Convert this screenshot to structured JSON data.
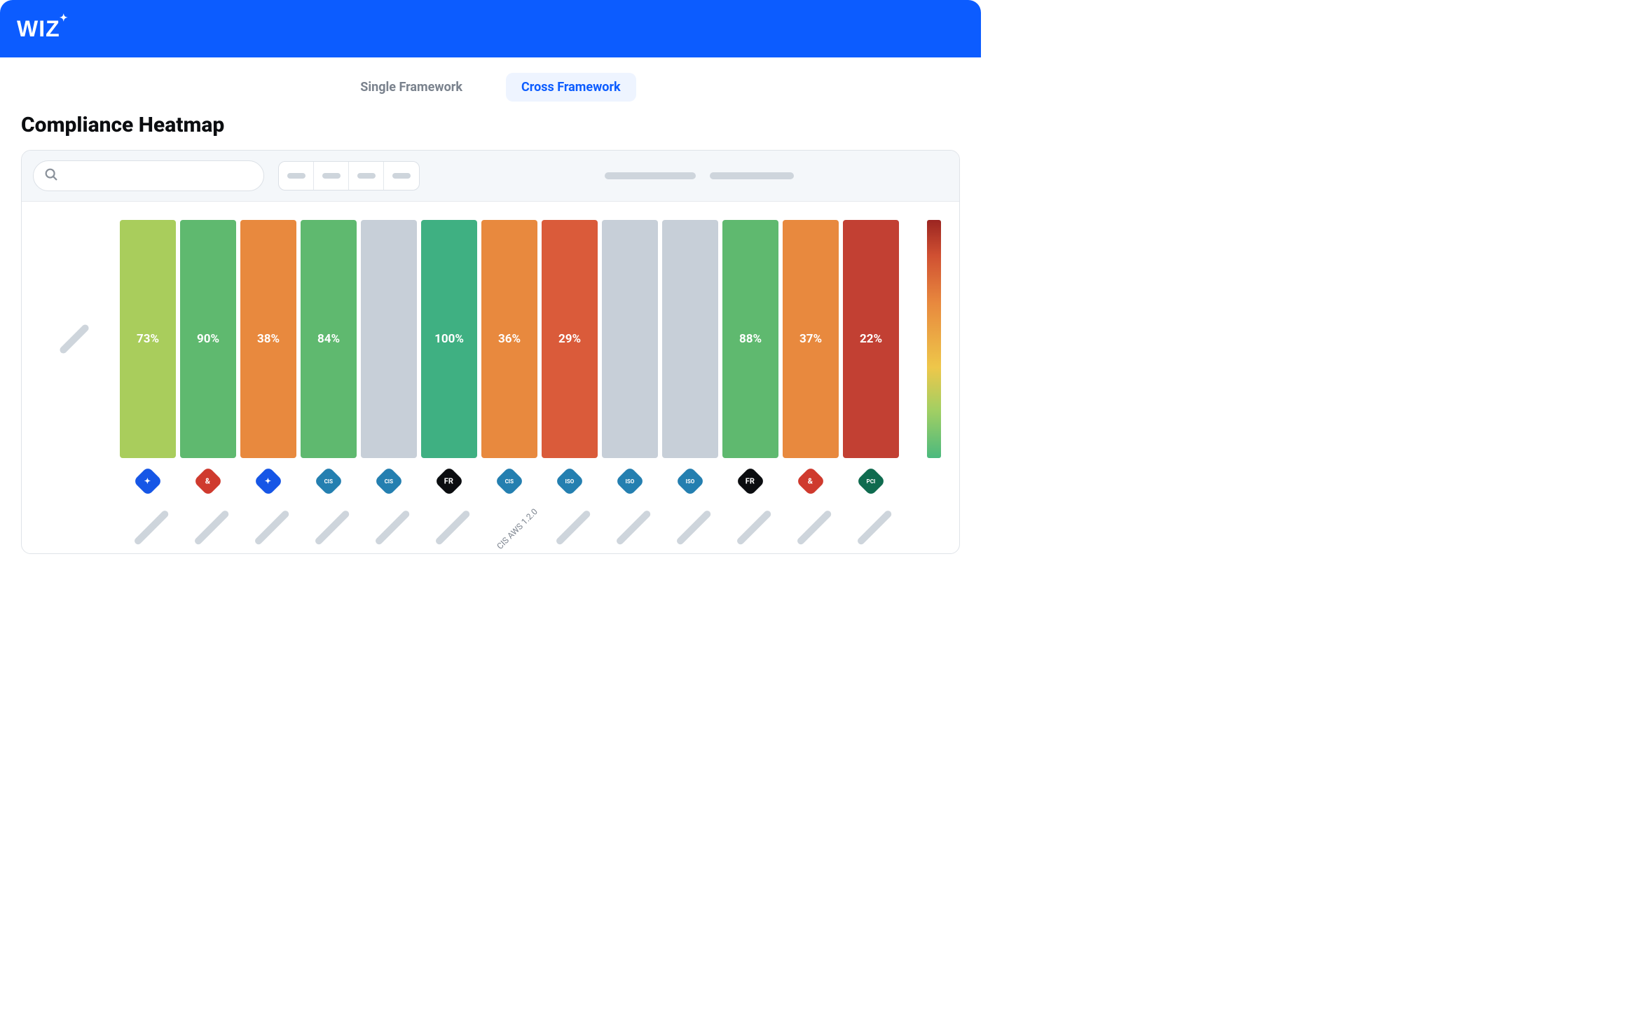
{
  "brand": "WIZ",
  "tabs": {
    "single": "Single Framework",
    "cross": "Cross Framework"
  },
  "title": "Compliance Heatmap",
  "search": {
    "placeholder": ""
  },
  "chart_data": {
    "type": "heatmap",
    "title": "Compliance Heatmap",
    "row_count": 1,
    "columns": [
      {
        "value": 73,
        "label": "",
        "icon": "star",
        "icon_color": "#1656e6",
        "cell_color": "#a9cd5c",
        "text": "73%"
      },
      {
        "value": 90,
        "label": "",
        "icon": "ampersand",
        "icon_color": "#cf3a2e",
        "cell_color": "#5fb96f",
        "text": "90%"
      },
      {
        "value": 38,
        "label": "",
        "icon": "star",
        "icon_color": "#1656e6",
        "cell_color": "#e8893e",
        "text": "38%"
      },
      {
        "value": 84,
        "label": "",
        "icon": "cis",
        "icon_color": "#247fb0",
        "cell_color": "#5fb96f",
        "text": "84%"
      },
      {
        "value": null,
        "label": "",
        "icon": "cis",
        "icon_color": "#247fb0",
        "cell_color": "#c7cfd8",
        "text": ""
      },
      {
        "value": 100,
        "label": "",
        "icon": "fr",
        "icon_color": "#0b0d10",
        "cell_color": "#3fb082",
        "text": "100%"
      },
      {
        "value": 36,
        "label": "CIS AWS 1.2.0",
        "icon": "cis",
        "icon_color": "#247fb0",
        "cell_color": "#e8893e",
        "text": "36%"
      },
      {
        "value": 29,
        "label": "",
        "icon": "iso",
        "icon_color": "#247fb0",
        "cell_color": "#da5b3a",
        "text": "29%"
      },
      {
        "value": null,
        "label": "",
        "icon": "iso",
        "icon_color": "#247fb0",
        "cell_color": "#c7cfd8",
        "text": ""
      },
      {
        "value": null,
        "label": "",
        "icon": "iso",
        "icon_color": "#247fb0",
        "cell_color": "#c7cfd8",
        "text": ""
      },
      {
        "value": 88,
        "label": "",
        "icon": "fr",
        "icon_color": "#0b0d10",
        "cell_color": "#5fb96f",
        "text": "88%"
      },
      {
        "value": 37,
        "label": "",
        "icon": "ampersand",
        "icon_color": "#cf3a2e",
        "cell_color": "#e8893e",
        "text": "37%"
      },
      {
        "value": 22,
        "label": "",
        "icon": "pci",
        "icon_color": "#0f6b4f",
        "cell_color": "#c24033",
        "text": "22%"
      }
    ],
    "legend": {
      "min": 0,
      "max": 100
    }
  },
  "icon_glyphs": {
    "star": "✦",
    "ampersand": "&",
    "cis": "CIS",
    "fr": "FR",
    "iso": "ISO",
    "pci": "PCI"
  }
}
